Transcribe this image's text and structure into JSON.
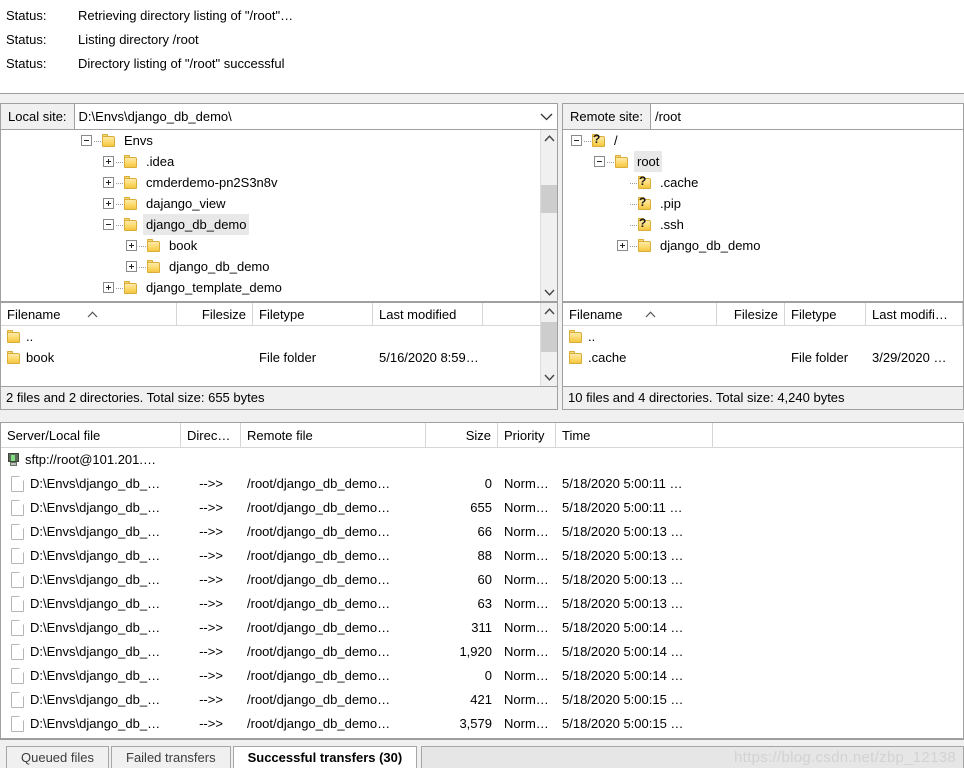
{
  "message_log": {
    "rows": [
      {
        "label": "Status:",
        "text": "Retrieving directory listing of \"/root\"…"
      },
      {
        "label": "Status:",
        "text": "Listing directory /root"
      },
      {
        "label": "Status:",
        "text": "Directory listing of \"/root\" successful"
      }
    ]
  },
  "local": {
    "site_label": "Local site:",
    "site_value": "D:\\Envs\\django_db_demo\\",
    "tree": [
      {
        "label": "Envs",
        "indent": 1,
        "expander": "minus",
        "icon": "folder",
        "selected": false
      },
      {
        "label": ".idea",
        "indent": 2,
        "expander": "plus",
        "icon": "folder",
        "selected": false
      },
      {
        "label": "cmderdemo-pn2S3n8v",
        "indent": 2,
        "expander": "plus",
        "icon": "folder",
        "selected": false
      },
      {
        "label": "dajango_view",
        "indent": 2,
        "expander": "plus",
        "icon": "folder",
        "selected": false
      },
      {
        "label": "django_db_demo",
        "indent": 2,
        "expander": "minus",
        "icon": "folder",
        "selected": true
      },
      {
        "label": "book",
        "indent": 3,
        "expander": "plus",
        "icon": "folder",
        "selected": false
      },
      {
        "label": "django_db_demo",
        "indent": 3,
        "expander": "plus",
        "icon": "folder",
        "selected": false
      },
      {
        "label": "django_template_demo",
        "indent": 2,
        "expander": "plus",
        "icon": "folder",
        "selected": false
      }
    ],
    "columns": [
      "Filename",
      "Filesize",
      "Filetype",
      "Last modified"
    ],
    "sort_column": "Filename",
    "sort_direction": "ascending",
    "rows": [
      {
        "name": "..",
        "filesize": "",
        "filetype": "",
        "modified": ""
      },
      {
        "name": "book",
        "filesize": "",
        "filetype": "File folder",
        "modified": "5/16/2020 8:59…"
      }
    ],
    "status": "2 files and 2 directories. Total size: 655 bytes"
  },
  "remote": {
    "site_label": "Remote site:",
    "site_value": "/root",
    "tree": [
      {
        "label": "/",
        "indent": 0,
        "expander": "minus",
        "icon": "question",
        "selected": false
      },
      {
        "label": "root",
        "indent": 1,
        "expander": "minus",
        "icon": "folder",
        "selected": true
      },
      {
        "label": ".cache",
        "indent": 2,
        "expander": "none",
        "icon": "question",
        "selected": false
      },
      {
        "label": ".pip",
        "indent": 2,
        "expander": "none",
        "icon": "question",
        "selected": false
      },
      {
        "label": ".ssh",
        "indent": 2,
        "expander": "none",
        "icon": "question",
        "selected": false
      },
      {
        "label": "django_db_demo",
        "indent": 2,
        "expander": "plus",
        "icon": "folder",
        "selected": false
      }
    ],
    "columns": [
      "Filename",
      "Filesize",
      "Filetype",
      "Last modifi…"
    ],
    "sort_column": "Filename",
    "sort_direction": "ascending",
    "rows": [
      {
        "name": "..",
        "filesize": "",
        "filetype": "",
        "modified": ""
      },
      {
        "name": ".cache",
        "filesize": "",
        "filetype": "File folder",
        "modified": "3/29/2020 …"
      }
    ],
    "status": "10 files and 4 directories. Total size: 4,240 bytes"
  },
  "queue": {
    "columns": [
      "Server/Local file",
      "Direc…",
      "Remote file",
      "Size",
      "Priority",
      "Time"
    ],
    "server_row": {
      "host": "sftp://root@101.201.…"
    },
    "rows": [
      {
        "local": "D:\\Envs\\django_db_…",
        "direction": "-->>",
        "remote": "/root/django_db_demo…",
        "size": "0",
        "priority": "Norm…",
        "time": "5/18/2020 5:00:11 …"
      },
      {
        "local": "D:\\Envs\\django_db_…",
        "direction": "-->>",
        "remote": "/root/django_db_demo…",
        "size": "655",
        "priority": "Norm…",
        "time": "5/18/2020 5:00:11 …"
      },
      {
        "local": "D:\\Envs\\django_db_…",
        "direction": "-->>",
        "remote": "/root/django_db_demo…",
        "size": "66",
        "priority": "Norm…",
        "time": "5/18/2020 5:00:13 …"
      },
      {
        "local": "D:\\Envs\\django_db_…",
        "direction": "-->>",
        "remote": "/root/django_db_demo…",
        "size": "88",
        "priority": "Norm…",
        "time": "5/18/2020 5:00:13 …"
      },
      {
        "local": "D:\\Envs\\django_db_…",
        "direction": "-->>",
        "remote": "/root/django_db_demo…",
        "size": "60",
        "priority": "Norm…",
        "time": "5/18/2020 5:00:13 …"
      },
      {
        "local": "D:\\Envs\\django_db_…",
        "direction": "-->>",
        "remote": "/root/django_db_demo…",
        "size": "63",
        "priority": "Norm…",
        "time": "5/18/2020 5:00:13 …"
      },
      {
        "local": "D:\\Envs\\django_db_…",
        "direction": "-->>",
        "remote": "/root/django_db_demo…",
        "size": "311",
        "priority": "Norm…",
        "time": "5/18/2020 5:00:14 …"
      },
      {
        "local": "D:\\Envs\\django_db_…",
        "direction": "-->>",
        "remote": "/root/django_db_demo…",
        "size": "1,920",
        "priority": "Norm…",
        "time": "5/18/2020 5:00:14 …"
      },
      {
        "local": "D:\\Envs\\django_db_…",
        "direction": "-->>",
        "remote": "/root/django_db_demo…",
        "size": "0",
        "priority": "Norm…",
        "time": "5/18/2020 5:00:14 …"
      },
      {
        "local": "D:\\Envs\\django_db_…",
        "direction": "-->>",
        "remote": "/root/django_db_demo…",
        "size": "421",
        "priority": "Norm…",
        "time": "5/18/2020 5:00:15 …"
      },
      {
        "local": "D:\\Envs\\django_db_…",
        "direction": "-->>",
        "remote": "/root/django_db_demo…",
        "size": "3,579",
        "priority": "Norm…",
        "time": "5/18/2020 5:00:15 …"
      }
    ]
  },
  "tabs": [
    {
      "label": "Queued files",
      "active": false
    },
    {
      "label": "Failed transfers",
      "active": false
    },
    {
      "label": "Successful transfers (30)",
      "active": true
    }
  ],
  "watermark": "https://blog.csdn.net/zbp_12138"
}
